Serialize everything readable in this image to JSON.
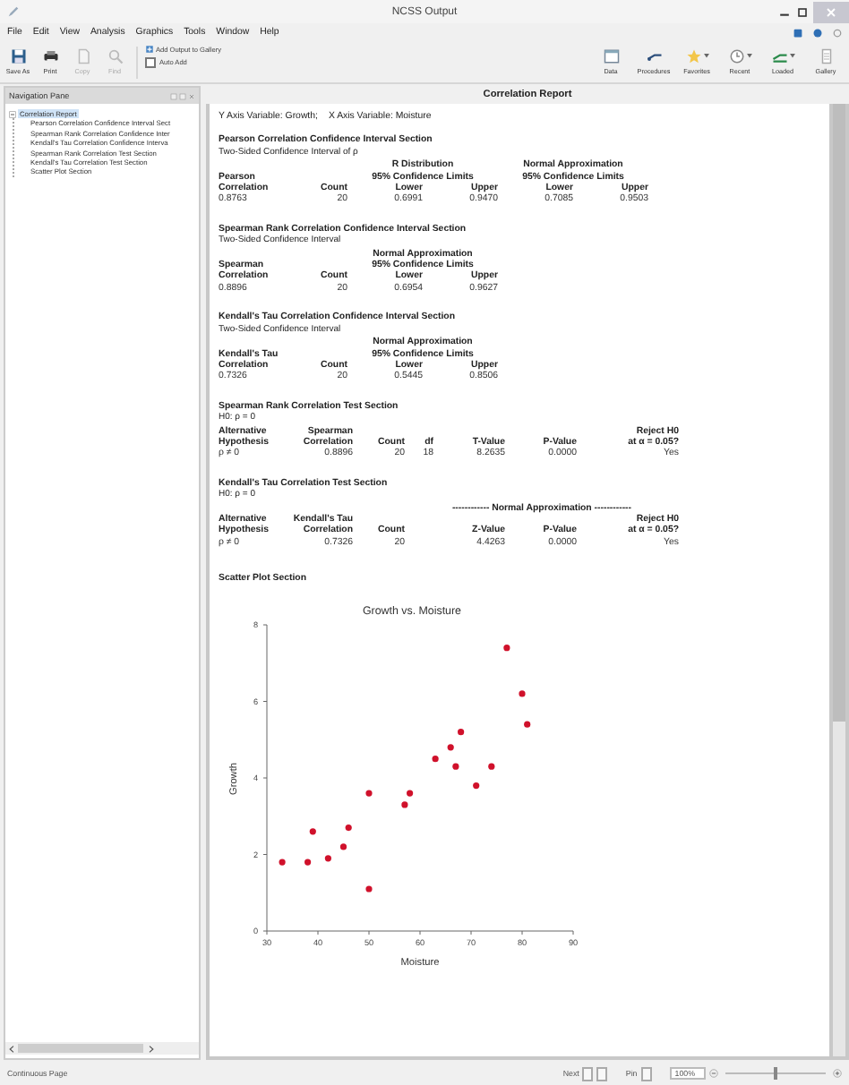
{
  "window": {
    "title": "NCSS Output"
  },
  "menu": [
    "File",
    "Edit",
    "View",
    "Analysis",
    "Graphics",
    "Tools",
    "Window",
    "Help"
  ],
  "toolbar": {
    "left": [
      {
        "kind": "save",
        "label": "Save As",
        "disabled": false
      },
      {
        "kind": "print",
        "label": "Print",
        "disabled": false
      },
      {
        "kind": "copy",
        "label": "Copy",
        "disabled": true
      },
      {
        "kind": "find",
        "label": "Find",
        "disabled": true
      }
    ],
    "gallery_button": "Add Output to Gallery",
    "auto_add": {
      "label": "Auto Add",
      "checked": false
    },
    "right": [
      {
        "kind": "data",
        "label": "Data",
        "dropdown": false
      },
      {
        "kind": "procedures",
        "label": "Procedures",
        "dropdown": false
      },
      {
        "kind": "favorites",
        "label": "Favorites",
        "dropdown": true
      },
      {
        "kind": "recent",
        "label": "Recent",
        "dropdown": true
      },
      {
        "kind": "loaded",
        "label": "Loaded",
        "dropdown": true
      },
      {
        "kind": "gallery",
        "label": "Gallery",
        "dropdown": false
      }
    ]
  },
  "navigation_pane": {
    "title": "Navigation Pane",
    "items": [
      {
        "label": "Correlation Report",
        "expanded": true,
        "children": [
          {
            "label": "Pearson Correlation Confidence Interval Sect"
          },
          {
            "label": "Spearman Rank Correlation Confidence Inter"
          },
          {
            "label": "Kendall's Tau Correlation Confidence Interva"
          },
          {
            "label": "Spearman Rank Correlation Test Section"
          },
          {
            "label": "Kendall's Tau Correlation Test Section"
          },
          {
            "label": "Scatter Plot Section"
          }
        ]
      }
    ]
  },
  "report": {
    "title": "Correlation Report",
    "variables": [
      "Y Axis Variable: Growth;",
      "X Axis Variable: Moisture"
    ],
    "sections": [
      {
        "title": "Pearson Correlation Confidence Interval Section",
        "subtitle": "Two-Sided Confidence Interval of ρ",
        "columns": [
          {
            "header": [
              "Pearson",
              "Correlation"
            ],
            "cells": [
              "0.8763"
            ]
          },
          {
            "header": [
              "Count"
            ],
            "cells": [
              "20"
            ]
          },
          {
            "kind": "group",
            "header": [
              "R Distribution",
              "95% Confidence Limits"
            ],
            "columns": [
              {
                "header": [
                  "Lower"
                ],
                "cells": [
                  "0.6991"
                ]
              },
              {
                "header": [
                  "Upper"
                ],
                "cells": [
                  "0.9470"
                ]
              }
            ]
          },
          {
            "kind": "group",
            "header": [
              "Normal Approximation",
              "95% Confidence Limits"
            ],
            "columns": [
              {
                "header": [
                  "Lower"
                ],
                "cells": [
                  "0.7085"
                ]
              },
              {
                "header": [
                  "Upper"
                ],
                "cells": [
                  "0.9503"
                ]
              }
            ]
          }
        ]
      },
      {
        "title": "Spearman Rank Correlation Confidence Interval Section",
        "subtitle": "Two-Sided Confidence Interval",
        "columns": [
          {
            "header": [
              "Spearman",
              "Correlation"
            ],
            "cells": [
              "0.8896"
            ]
          },
          {
            "header": [
              "Count"
            ],
            "cells": [
              "20"
            ]
          },
          {
            "kind": "group",
            "header": [
              "Normal Approximation",
              "95% Confidence Limits"
            ],
            "columns": [
              {
                "header": [
                  "Lower"
                ],
                "cells": [
                  "0.6954"
                ]
              },
              {
                "header": [
                  "Upper"
                ],
                "cells": [
                  "0.9627"
                ]
              }
            ]
          }
        ]
      },
      {
        "title": "Kendall's Tau Correlation Confidence Interval Section",
        "subtitle": "Two-Sided Confidence Interval",
        "columns": [
          {
            "header": [
              "Kendall's Tau",
              "Correlation"
            ],
            "cells": [
              "0.7326"
            ]
          },
          {
            "header": [
              "Count"
            ],
            "cells": [
              "20"
            ]
          },
          {
            "kind": "group",
            "header": [
              "Normal Approximation",
              "95% Confidence Limits"
            ],
            "columns": [
              {
                "header": [
                  "Lower"
                ],
                "cells": [
                  "0.5445"
                ]
              },
              {
                "header": [
                  "Upper"
                ],
                "cells": [
                  "0.8506"
                ]
              }
            ]
          }
        ]
      },
      {
        "title": "Spearman Rank Correlation Test Section",
        "subtitle": "H0: ρ = 0",
        "columns": [
          {
            "header": [
              "Alternative",
              "Hypothesis"
            ],
            "cells": [
              "ρ ≠ 0"
            ]
          },
          {
            "header": [
              "Spearman",
              "Correlation"
            ],
            "cells": [
              "0.8896"
            ]
          },
          {
            "header": [
              "Count"
            ],
            "cells": [
              "20"
            ]
          },
          {
            "header": [
              "df"
            ],
            "cells": [
              "18"
            ]
          },
          {
            "header": [
              "T-Value"
            ],
            "cells": [
              "8.2635"
            ]
          },
          {
            "header": [
              "P-Value"
            ],
            "cells": [
              "0.0000"
            ]
          },
          {
            "header": [
              "Reject H0",
              "at α = 0.05?"
            ],
            "cells": [
              "Yes"
            ]
          }
        ]
      },
      {
        "title": "Kendall's Tau Correlation Test Section",
        "subtitle": "H0: ρ = 0",
        "columns": [
          {
            "header": [
              "Alternative",
              "Hypothesis"
            ],
            "cells": [
              "ρ ≠ 0"
            ]
          },
          {
            "header": [
              "Kendall's Tau",
              "Correlation"
            ],
            "cells": [
              "0.7326"
            ]
          },
          {
            "header": [
              "Count"
            ],
            "cells": [
              "20"
            ]
          },
          {
            "kind": "group",
            "header": [
              "------------ Normal Approximation ------------"
            ],
            "columns": [
              {
                "header": [
                  "Z-Value"
                ],
                "cells": [
                  "4.4263"
                ]
              },
              {
                "header": [
                  "P-Value"
                ],
                "cells": [
                  "0.0000"
                ]
              },
              {
                "header": [
                  "Reject H0",
                  "at α = 0.05?"
                ],
                "cells": [
                  "Yes"
                ]
              }
            ]
          }
        ]
      }
    ],
    "scatter_title": "Scatter Plot Section",
    "chart_data": {
      "type": "scatter",
      "title": "Growth vs. Moisture",
      "xlabel": "Moisture",
      "ylabel": "Growth",
      "x": [
        33,
        38,
        39,
        42,
        45,
        46,
        50,
        50,
        57,
        58,
        63,
        66,
        67,
        68,
        71,
        74,
        77,
        80,
        81
      ],
      "series": [
        {
          "color": "#d0112b",
          "values": [
            1.8,
            1.8,
            2.6,
            1.9,
            2.2,
            2.7,
            3.6,
            1.1,
            3.3,
            3.6,
            4.5,
            4.8,
            4.3,
            5.2,
            3.8,
            4.3,
            7.4,
            6.2,
            5.4
          ]
        }
      ],
      "xlim": [
        30,
        90
      ],
      "ylim": [
        0,
        8
      ],
      "xticks": [
        30,
        40,
        50,
        60,
        70,
        80,
        90
      ],
      "yticks": [
        0,
        2,
        4,
        6,
        8
      ]
    }
  },
  "status_bar": {
    "view": "Continuous Page",
    "next": "Next",
    "pin": "Pin",
    "zoom": "100%",
    "zoom_slider": {
      "level": 0.5
    }
  }
}
